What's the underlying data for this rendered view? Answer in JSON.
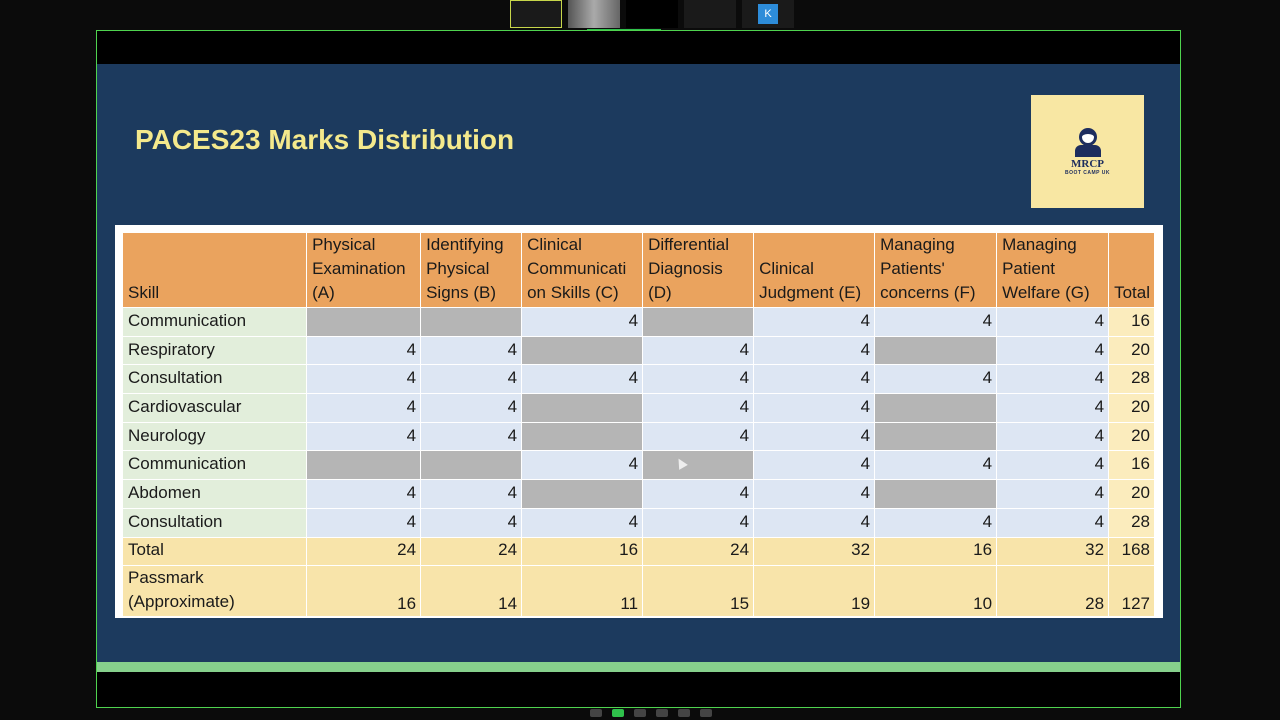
{
  "meeting": {
    "thumbnails": [
      "",
      "",
      "",
      "",
      "K"
    ]
  },
  "slide": {
    "title": "PACES23 Marks Distribution",
    "logo": {
      "main": "MRCP",
      "sub": "BOOT CAMP UK"
    }
  },
  "table": {
    "headers": [
      "Skill",
      "Physical Examination (A)",
      "Identifying Physical Signs (B)",
      "Clinical Communicati on Skills (C)",
      "Differential Diagnosis (D)",
      "Clinical Judgment (E)",
      "Managing Patients' concerns (F)",
      "Managing Patient Welfare (G)",
      "Total"
    ],
    "rows": [
      {
        "skill": "Communication",
        "values": [
          null,
          null,
          4,
          null,
          4,
          4,
          4
        ],
        "total": 16
      },
      {
        "skill": "Respiratory",
        "values": [
          4,
          4,
          null,
          4,
          4,
          null,
          4
        ],
        "total": 20
      },
      {
        "skill": "Consultation",
        "values": [
          4,
          4,
          4,
          4,
          4,
          4,
          4
        ],
        "total": 28
      },
      {
        "skill": "Cardiovascular",
        "values": [
          4,
          4,
          null,
          4,
          4,
          null,
          4
        ],
        "total": 20
      },
      {
        "skill": "Neurology",
        "values": [
          4,
          4,
          null,
          4,
          4,
          null,
          4
        ],
        "total": 20
      },
      {
        "skill": "Communication",
        "values": [
          null,
          null,
          4,
          null,
          4,
          4,
          4
        ],
        "total": 16
      },
      {
        "skill": "Abdomen",
        "values": [
          4,
          4,
          null,
          4,
          4,
          null,
          4
        ],
        "total": 20
      },
      {
        "skill": "Consultation",
        "values": [
          4,
          4,
          4,
          4,
          4,
          4,
          4
        ],
        "total": 28
      }
    ],
    "total_row": {
      "label": "Total",
      "values": [
        24,
        24,
        16,
        24,
        32,
        16,
        32
      ],
      "total": 168
    },
    "passmark_row": {
      "label": "Passmark (Approximate)",
      "values": [
        16,
        14,
        11,
        15,
        19,
        10,
        28
      ],
      "total": 127
    }
  }
}
